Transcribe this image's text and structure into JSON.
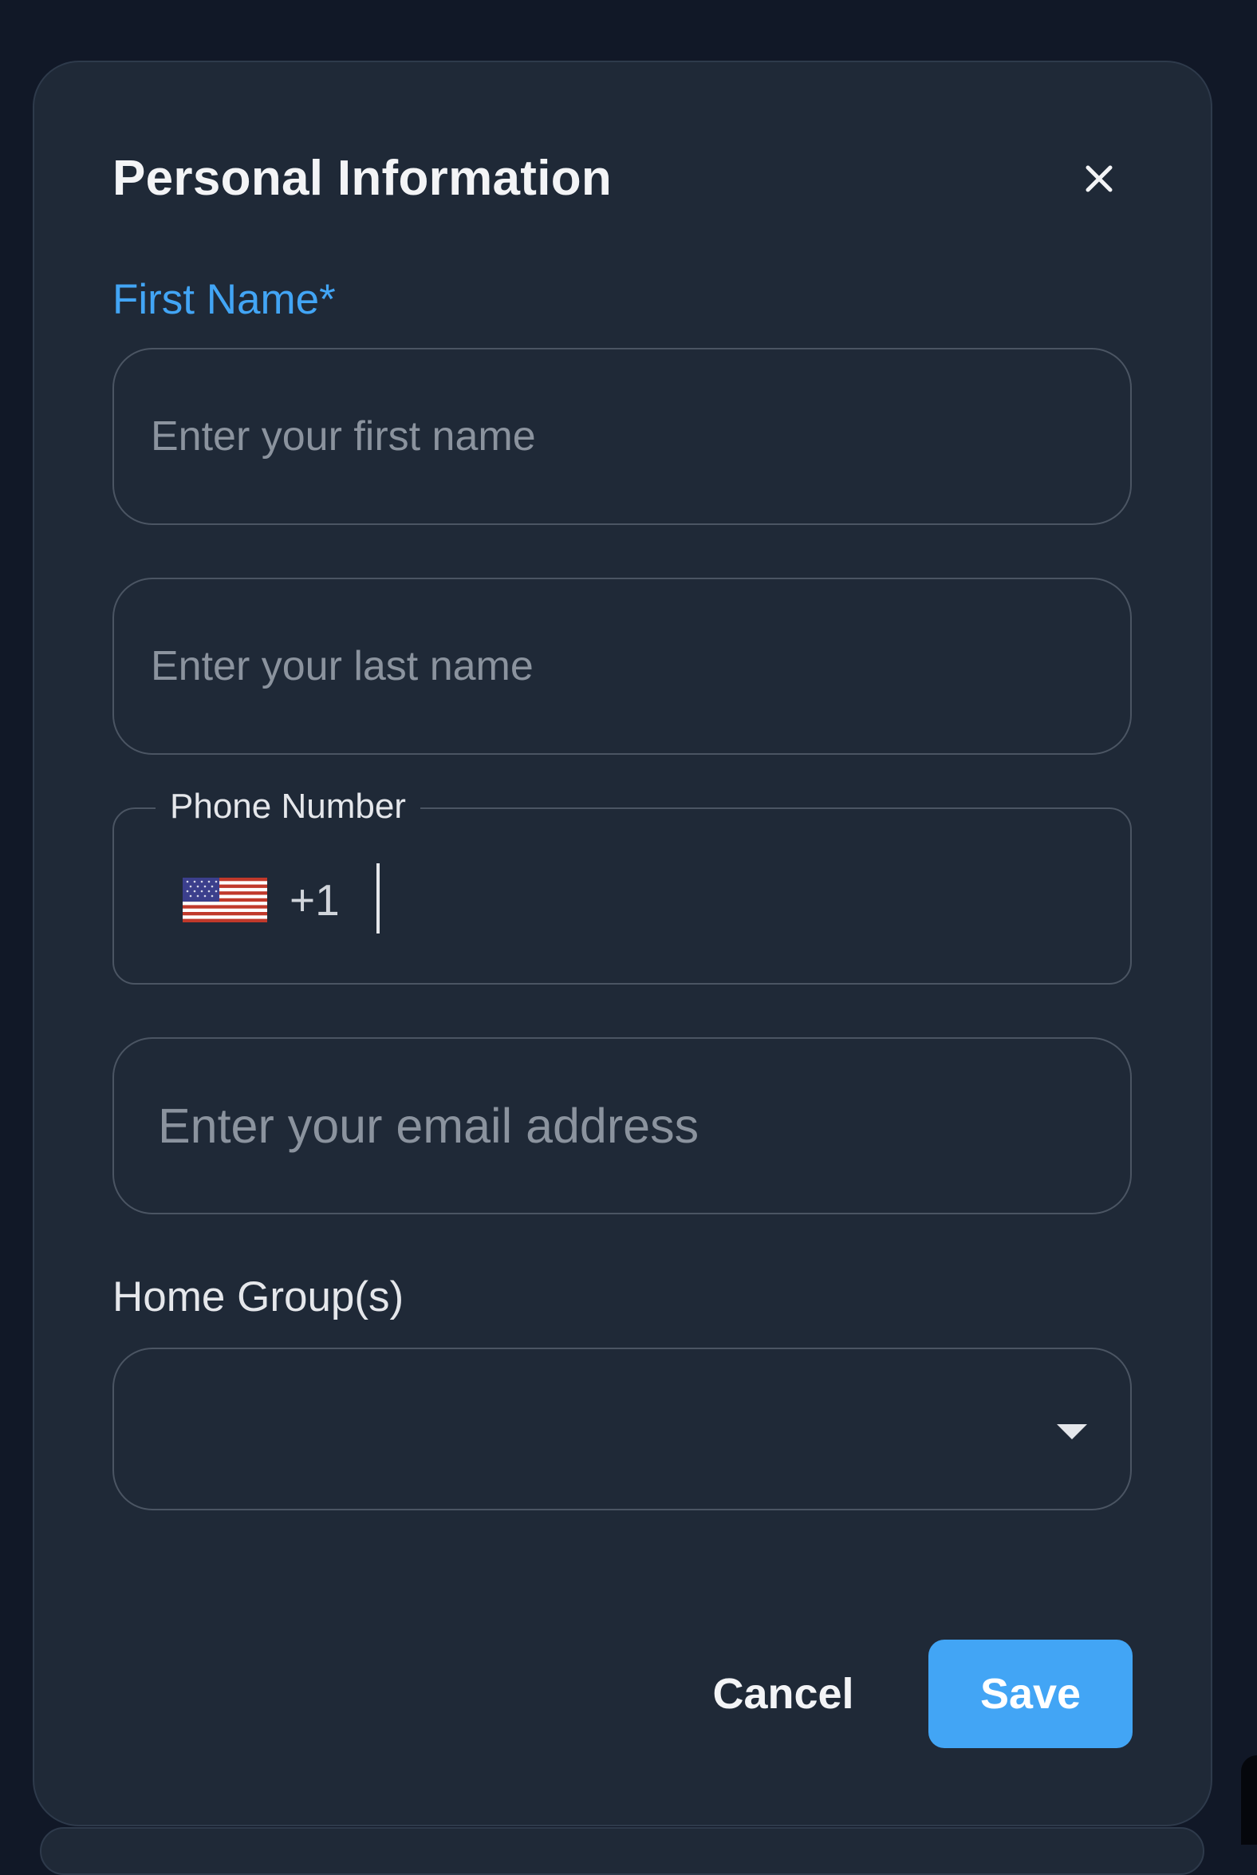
{
  "dialog": {
    "title": "Personal Information",
    "close_icon": "close-icon"
  },
  "form": {
    "first_name": {
      "label": "First Name*",
      "placeholder": "Enter your first name",
      "value": ""
    },
    "last_name": {
      "placeholder": "Enter your last name",
      "value": ""
    },
    "phone": {
      "label": "Phone Number",
      "country_flag": "us-flag-icon",
      "dial_code": "+1",
      "value": ""
    },
    "email": {
      "placeholder": "Enter your email address",
      "value": ""
    },
    "home_groups": {
      "label": "Home Group(s)",
      "selected": "",
      "arrow_icon": "dropdown-arrow-icon"
    }
  },
  "actions": {
    "cancel_label": "Cancel",
    "save_label": "Save"
  },
  "colors": {
    "background": "#111827",
    "panel": "#1f2937",
    "accent": "#42a5f5",
    "border": "#4b5563"
  }
}
